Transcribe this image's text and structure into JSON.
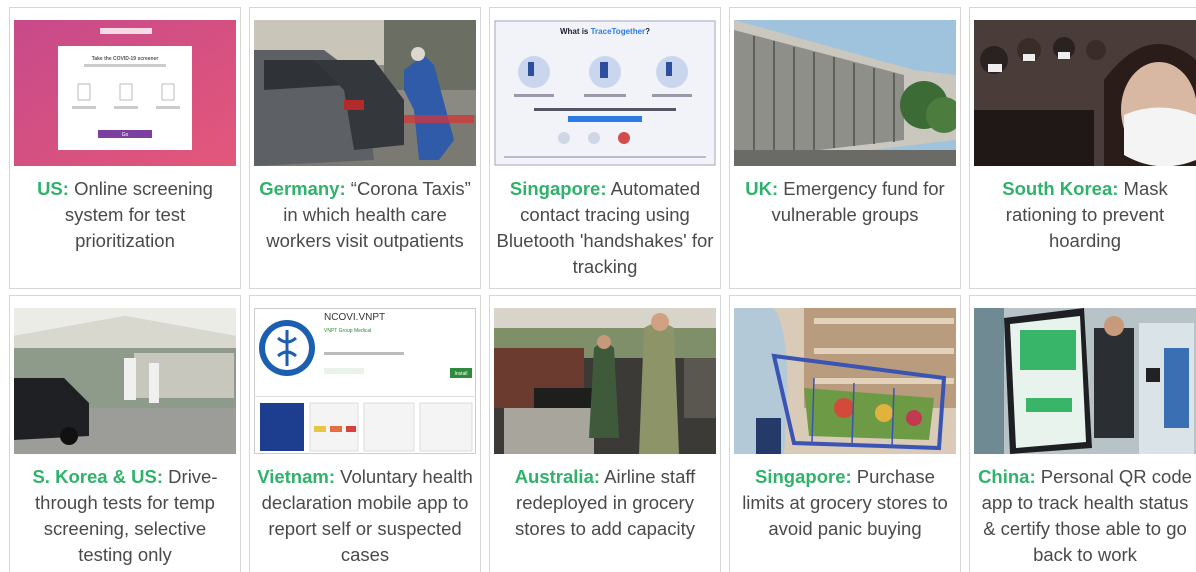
{
  "cards": [
    {
      "country": "US:",
      "text": " Online screening system for test prioritization",
      "image": "online-screening-screenshot",
      "embedded": {
        "title": "Take the COVID-19 screener",
        "button": "Go"
      }
    },
    {
      "country": "Germany:",
      "text": " “Corona Taxis” in which health care workers visit outpatients",
      "image": "drive-up-testing-photo"
    },
    {
      "country": "Singapore:",
      "text": " Automated contact tracing using Bluetooth 'handshakes' for tracking",
      "image": "tracetogether-infographic",
      "embedded": {
        "title_prefix": "What is ",
        "title_brand": "TraceTogether",
        "title_suffix": "?"
      }
    },
    {
      "country": "UK:",
      "text": " Emergency fund for vulnerable groups",
      "image": "government-building-photo"
    },
    {
      "country": "South Korea:",
      "text": " Mask rationing to prevent hoarding",
      "image": "crowd-masks-photo"
    },
    {
      "country": "S. Korea & US:",
      "text": " Drive-through tests for temp screening, selective testing only",
      "image": "drive-through-tent-photo"
    },
    {
      "country": "Vietnam:",
      "text": " Voluntary health declaration mobile app to report self or suspected cases",
      "image": "ncovi-app-screenshot",
      "embedded": {
        "app_name": "NCOVI.VNPT",
        "developer": "VNPT Group",
        "category": "Medical",
        "install": "Install"
      }
    },
    {
      "country": "Australia:",
      "text": " Airline staff redeployed in grocery stores to add capacity",
      "image": "grocery-checkout-photo"
    },
    {
      "country": "Singapore:",
      "text": " Purchase limits at grocery stores to avoid panic buying",
      "image": "shopping-cart-photo"
    },
    {
      "country": "China:",
      "text": " Personal QR code app to track health status & certify those able to go back to work",
      "image": "qr-code-phone-photo"
    }
  ],
  "colors": {
    "country_green": "#2fb36b",
    "body_text": "#4a4a4a",
    "border": "#d6d6d6"
  }
}
